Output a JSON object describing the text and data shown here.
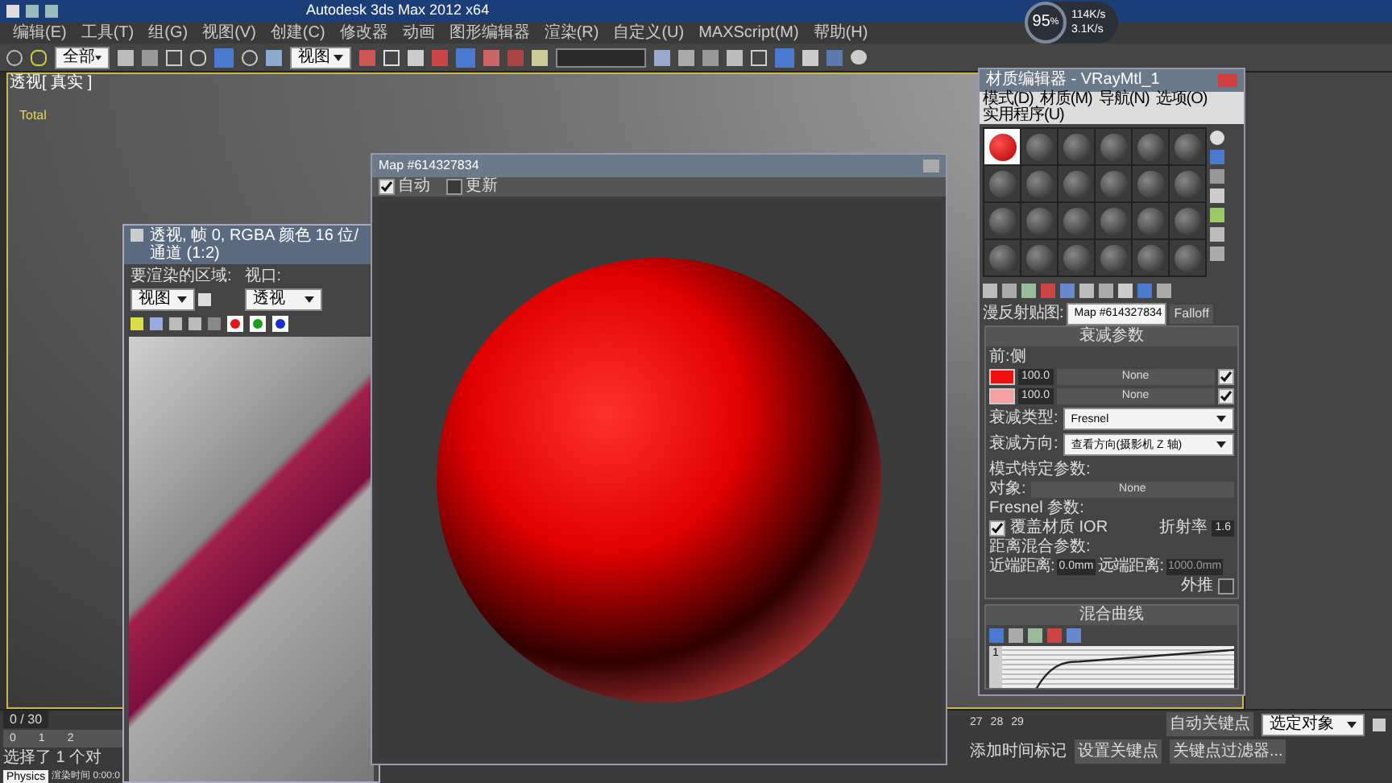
{
  "title_bar": {
    "app_title": "Autodesk 3ds Max  2012 x64"
  },
  "network_widget": {
    "percent": "95",
    "unit": "%",
    "upload": "114K/s",
    "download": "3.1K/s"
  },
  "menu": [
    "编辑(E)",
    "工具(T)",
    "组(G)",
    "视图(V)",
    "创建(C)",
    "修改器",
    "动画",
    "图形编辑器",
    "渲染(R)",
    "自定义(U)",
    "MAXScript(M)",
    "帮助(H)"
  ],
  "toolbar": {
    "selection_filter": "全部",
    "coordinate_system": "视图"
  },
  "viewport": {
    "label": "透视[ 真实 ]",
    "stats": [
      "Total"
    ]
  },
  "render_frame": {
    "title": "透视, 帧 0, RGBA 颜色 16 位/通道 (1:2)",
    "area_label": "要渲染的区域:",
    "area_value": "视图",
    "viewport_label": "视口:",
    "viewport_value": "透视",
    "channels": [
      {
        "color": "#e01818"
      },
      {
        "color": "#18a018"
      },
      {
        "color": "#1830d0"
      }
    ]
  },
  "map_window": {
    "title": "Map #614327834",
    "toolbar": [
      {
        "label": "自动",
        "checked": true
      },
      {
        "label": "更新",
        "checked": false
      }
    ]
  },
  "material_editor": {
    "title": "材质编辑器 - VRayMtl_1",
    "menu": [
      "模式(D)",
      "材质(M)",
      "导航(N)",
      "选项(O)",
      "实用程序(U)"
    ],
    "slots": [
      {
        "selected": true
      },
      {
        "selected": false
      },
      {
        "selected": false
      },
      {
        "selected": false
      },
      {
        "selected": false
      },
      {
        "selected": false
      },
      {
        "selected": false
      },
      {
        "selected": false
      },
      {
        "selected": false
      },
      {
        "selected": false
      },
      {
        "selected": false
      },
      {
        "selected": false
      },
      {
        "selected": false
      },
      {
        "selected": false
      },
      {
        "selected": false
      },
      {
        "selected": false
      },
      {
        "selected": false
      },
      {
        "selected": false
      },
      {
        "selected": false
      },
      {
        "selected": false
      },
      {
        "selected": false
      },
      {
        "selected": false
      },
      {
        "selected": false
      },
      {
        "selected": false
      }
    ],
    "map_label": "漫反射贴图:",
    "map_name": "Map #614327834",
    "map_type": "Falloff",
    "falloff": {
      "title": "衰减参数",
      "group_label": "前:侧",
      "colors": [
        {
          "color": "#f01010",
          "amount": "100.0",
          "map": "None",
          "enabled": true
        },
        {
          "color": "#f4a0a0",
          "amount": "100.0",
          "map": "None",
          "enabled": true
        }
      ],
      "type_label": "衰减类型:",
      "type_value": "Fresnel",
      "direction_label": "衰减方向:",
      "direction_value": "查看方向(摄影机 Z 轴)",
      "mode_title": "模式特定参数:",
      "object_label": "对象:",
      "object_value": "None",
      "fresnel_title": "Fresnel 参数:",
      "override_ior": {
        "label": "覆盖材质 IOR",
        "checked": true
      },
      "ior_label": "折射率",
      "ior_value": "1.6",
      "distance_title": "距离混合参数:",
      "near_label": "近端距离:",
      "near_value": "0.0mm",
      "far_label": "远端距离:",
      "far_value": "1000.0mm",
      "extrapolate": {
        "label": "外推",
        "checked": false
      }
    },
    "curve": {
      "title": "混合曲线",
      "axis_label": "1"
    }
  },
  "timeline": {
    "frame": "0 / 30",
    "ticks": [
      "0",
      "1",
      "2"
    ],
    "right_ticks": [
      "27",
      "28",
      "29"
    ]
  },
  "physics_tab": "Physics",
  "status": {
    "selection": "选择了 1 个对",
    "render_time": "渲染时间 0:00:0",
    "auto_key": "自动关键点",
    "key_dropdown": "选定对象",
    "set_key": "设置关键点",
    "key_filters": "关键点过滤器...",
    "add_tag": "添加时间标记"
  }
}
